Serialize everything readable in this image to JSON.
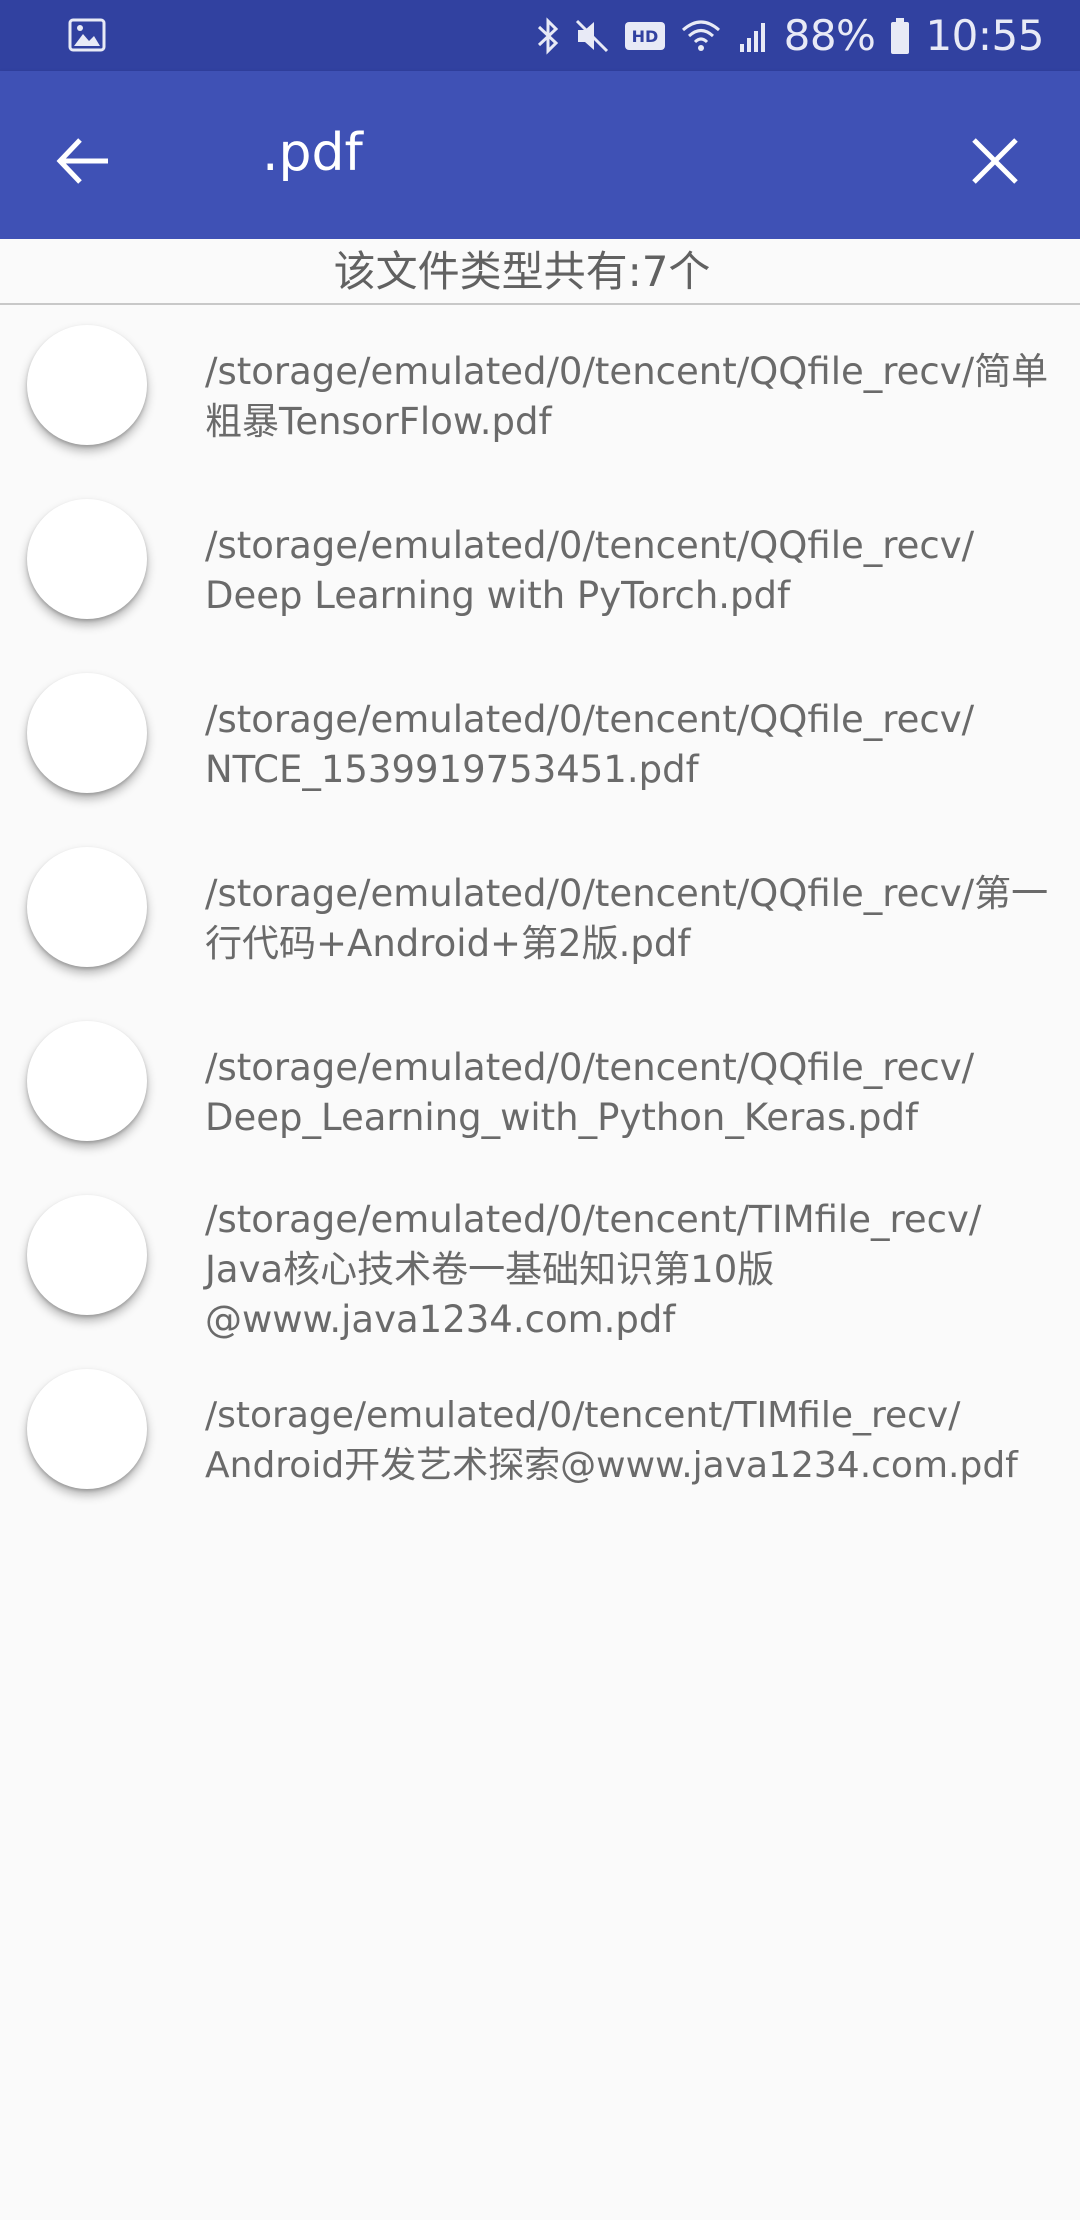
{
  "status_bar": {
    "battery": "88%",
    "time": "10:55",
    "icons": [
      "gallery-icon",
      "bluetooth-icon",
      "mute-icon",
      "hd-icon",
      "wifi-icon",
      "signal-4g-icon",
      "battery-icon"
    ]
  },
  "app_bar": {
    "query": ".pdf",
    "back_icon": "arrow-back-icon",
    "clear_icon": "close-icon"
  },
  "count_text": "该文件类型共有:7个",
  "files": [
    "/storage/emulated/0/tencent/QQfile_recv/简单粗暴TensorFlow.pdf",
    "/storage/emulated/0/tencent/QQfile_recv/\nDeep Learning with PyTorch.pdf",
    "/storage/emulated/0/tencent/QQfile_recv/\nNTCE_1539919753451.pdf",
    "/storage/emulated/0/tencent/QQfile_recv/第一行代码+Android+第2版.pdf",
    "/storage/emulated/0/tencent/QQfile_recv/\nDeep_Learning_with_Python_Keras.pdf",
    "/storage/emulated/0/tencent/TIMfile_recv/\nJava核心技术卷一基础知识第10版\n@www.java1234.com.pdf",
    "/storage/emulated/0/tencent/TIMfile_recv/\nAndroid开发艺术探索@www.java1234.com.pdf"
  ]
}
